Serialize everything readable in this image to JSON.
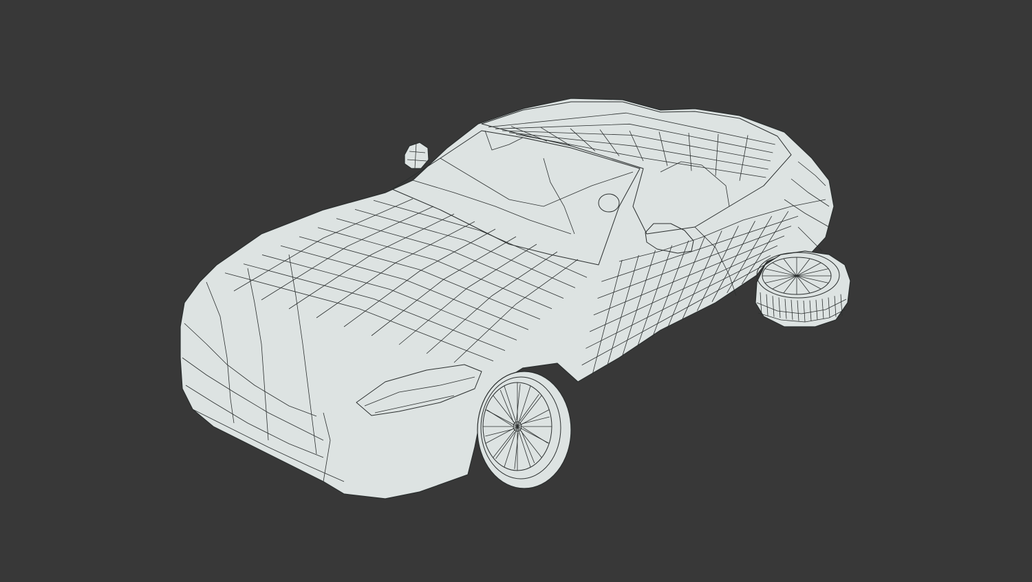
{
  "viewport": {
    "background_color": "#383838",
    "mesh_fill_color": "#dde3e2",
    "wire_color": "#2a2e2e",
    "display_mode": "wireframe-on-shaded"
  },
  "scene": {
    "objects": [
      {
        "name": "car-body"
      },
      {
        "name": "front-wheel"
      },
      {
        "name": "rear-wheel"
      },
      {
        "name": "side-mirror-left"
      },
      {
        "name": "side-mirror-right"
      }
    ]
  }
}
